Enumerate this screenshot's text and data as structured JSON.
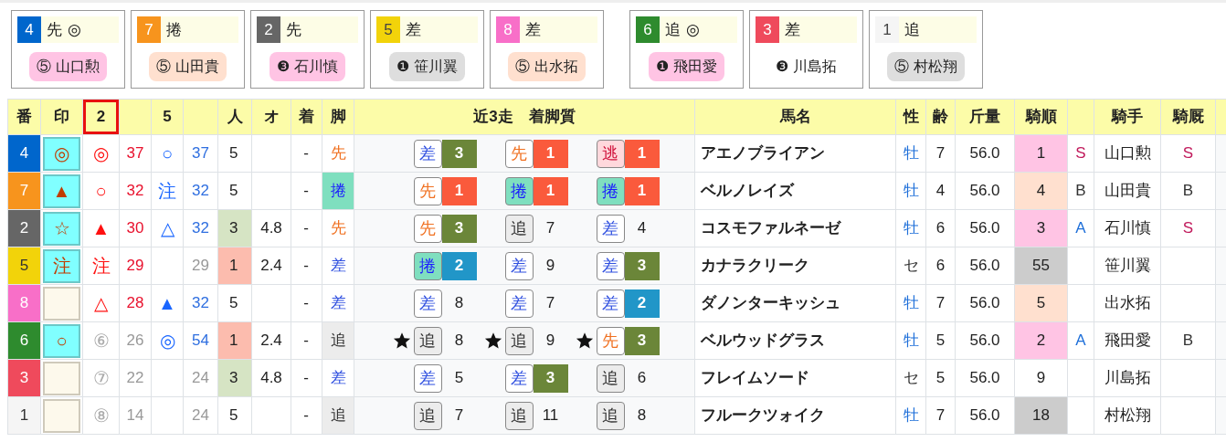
{
  "card_groups": [
    {
      "cards": [
        {
          "number": "4",
          "color": "#0066cc",
          "style": "先",
          "mark": "◎",
          "jockey": {
            "text": "⑤ 山口勲",
            "color": "#ffc4e4"
          }
        },
        {
          "number": "7",
          "color": "#f7941d",
          "style": "捲",
          "jockey": {
            "text": "⑤ 山田貴",
            "color": "#ffe0cf"
          }
        },
        {
          "number": "2",
          "color": "#666666",
          "style": "先",
          "jockey": {
            "text": "❸ 石川慎",
            "color": "#ffc4e4"
          }
        },
        {
          "number": "5",
          "color": "#f2d30a",
          "style": "差",
          "jockey": {
            "text": "❶ 笹川翼",
            "color": "#dedede"
          }
        },
        {
          "number": "8",
          "color": "#f86fc8",
          "style": "差",
          "jockey": {
            "text": "⑤ 出水拓",
            "color": "#ffe0cf"
          }
        }
      ]
    },
    {
      "cards": [
        {
          "number": "6",
          "color": "#2e8b2e",
          "style": "追",
          "mark": "◎",
          "jockey": {
            "text": "❶ 飛田愛",
            "color": "#ffc4e4"
          }
        },
        {
          "number": "3",
          "color": "#ef4a5c",
          "style": "差",
          "jockey": {
            "text": "❸ 川島拓"
          }
        },
        {
          "number": "1",
          "color": "#f5f5f5",
          "style": "追",
          "jockey": {
            "text": "⑤ 村松翔",
            "color": "#dedede"
          }
        }
      ]
    }
  ],
  "table": {
    "columns": [
      {
        "kind": "label",
        "label": "番",
        "selected": false
      },
      {
        "kind": "label",
        "label": "印",
        "selected": false
      },
      {
        "kind": "label",
        "label": "2",
        "selected": true
      },
      {
        "kind": "blank",
        "selected": false
      },
      {
        "kind": "label",
        "label": "5",
        "selected": false
      },
      {
        "kind": "blank",
        "selected": false
      },
      {
        "kind": "label",
        "label": "人",
        "selected": false
      },
      {
        "kind": "label",
        "label": "オ",
        "selected": false
      },
      {
        "kind": "label",
        "label": "着",
        "selected": false
      },
      {
        "kind": "label",
        "label": "脚",
        "selected": false
      },
      {
        "kind": "label",
        "label": "近3走　着脚質",
        "selected": false
      },
      {
        "kind": "label",
        "label": "馬名",
        "selected": false
      },
      {
        "kind": "label",
        "label": "性",
        "selected": false
      },
      {
        "kind": "label",
        "label": "齢",
        "selected": false
      },
      {
        "kind": "label",
        "label": "斤量",
        "selected": false
      },
      {
        "kind": "label",
        "label": "騎順",
        "selected": false
      },
      {
        "kind": "blank",
        "selected": false
      },
      {
        "kind": "label",
        "label": "騎手",
        "selected": false
      },
      {
        "kind": "label",
        "label": "騎厩",
        "selected": false
      },
      {
        "kind": "blank",
        "selected": false
      }
    ],
    "rows": [
      {
        "number": "4",
        "color": "#0066cc",
        "mark": "◎",
        "index_2": {
          "mark": "◎",
          "value": "37",
          "emphasized": true
        },
        "index_5": {
          "mark": "○",
          "value": "37",
          "emphasized": true
        },
        "popularity": {
          "text": "5"
        },
        "finish": "-",
        "style": {
          "text": "先",
          "kind": "senko"
        },
        "runs": [
          {
            "starred": false,
            "style": {
              "text": "差",
              "kind": "sashi"
            },
            "finish": "3",
            "color": "#6b8639"
          },
          {
            "starred": false,
            "style": {
              "text": "先",
              "kind": "senko"
            },
            "finish": "1",
            "color": "#fa5a3c"
          },
          {
            "starred": false,
            "style": {
              "text": "逃",
              "kind": "nige"
            },
            "finish": "1",
            "color": "#fa5a3c"
          }
        ],
        "name": "アエノブライアン",
        "sex": {
          "text": "牡",
          "color": "#1e6fd9"
        },
        "age": "7",
        "weight": "56.0",
        "jockey_rank": {
          "text": "1",
          "color": "#ffc4e4"
        },
        "grade": {
          "text": "S",
          "color": "#c0185a"
        },
        "jockey": "山口勲",
        "stable_grade": {
          "text": "S",
          "color": "#c0185a"
        }
      },
      {
        "number": "7",
        "color": "#f7941d",
        "mark": "▲",
        "index_2": {
          "mark": "○",
          "value": "32",
          "emphasized": true
        },
        "index_5": {
          "mark": "注",
          "value": "32",
          "emphasized": true
        },
        "popularity": {
          "text": "5"
        },
        "finish": "-",
        "style": {
          "text": "捲",
          "kind": "makuri"
        },
        "runs": [
          {
            "starred": false,
            "style": {
              "text": "先",
              "kind": "senko"
            },
            "finish": "1",
            "color": "#fa5a3c"
          },
          {
            "starred": false,
            "style": {
              "text": "捲",
              "kind": "makuri"
            },
            "finish": "1",
            "color": "#fa5a3c"
          },
          {
            "starred": false,
            "style": {
              "text": "捲",
              "kind": "makuri"
            },
            "finish": "1",
            "color": "#fa5a3c"
          }
        ],
        "name": "ベルノレイズ",
        "sex": {
          "text": "牡",
          "color": "#1e6fd9"
        },
        "age": "4",
        "weight": "56.0",
        "jockey_rank": {
          "text": "4",
          "color": "#ffe0cf"
        },
        "grade": {
          "text": "B",
          "color": "#333333"
        },
        "jockey": "山田貴",
        "stable_grade": {
          "text": "B",
          "color": "#333333"
        }
      },
      {
        "number": "2",
        "color": "#666666",
        "mark": "☆",
        "index_2": {
          "mark": "▲",
          "value": "30",
          "emphasized": true
        },
        "index_5": {
          "mark": "△",
          "value": "32",
          "emphasized": true
        },
        "popularity": {
          "text": "3",
          "color": "#d6e4c4"
        },
        "odds": "4.8",
        "finish": "-",
        "style": {
          "text": "先",
          "kind": "senko"
        },
        "runs": [
          {
            "starred": false,
            "style": {
              "text": "先",
              "kind": "senko"
            },
            "finish": "3",
            "color": "#6b8639"
          },
          {
            "starred": false,
            "style": {
              "text": "追",
              "kind": "oikomi"
            },
            "finish": "7"
          },
          {
            "starred": false,
            "style": {
              "text": "差",
              "kind": "sashi"
            },
            "finish": "4"
          }
        ],
        "name": "コスモファルネーゼ",
        "sex": {
          "text": "牡",
          "color": "#1e6fd9"
        },
        "age": "6",
        "weight": "56.0",
        "jockey_rank": {
          "text": "3",
          "color": "#ffc4e4"
        },
        "grade": {
          "text": "A",
          "color": "#1e6fd9"
        },
        "jockey": "石川慎",
        "stable_grade": {
          "text": "S",
          "color": "#c0185a"
        }
      },
      {
        "number": "5",
        "color": "#f2d30a",
        "mark": "注",
        "index_2": {
          "mark": "注",
          "value": "29",
          "emphasized": true
        },
        "index_5": {
          "value": "29",
          "emphasized": false
        },
        "popularity": {
          "text": "1",
          "color": "#fcbcae"
        },
        "odds": "2.4",
        "finish": "-",
        "style": {
          "text": "差",
          "kind": "sashi"
        },
        "runs": [
          {
            "starred": false,
            "style": {
              "text": "捲",
              "kind": "makuri"
            },
            "finish": "2",
            "color": "#2196c8"
          },
          {
            "starred": false,
            "style": {
              "text": "差",
              "kind": "sashi"
            },
            "finish": "9"
          },
          {
            "starred": false,
            "style": {
              "text": "差",
              "kind": "sashi"
            },
            "finish": "3",
            "color": "#6b8639"
          }
        ],
        "name": "カナラクリーク",
        "sex": {
          "text": "セ",
          "color": "#333333"
        },
        "age": "6",
        "weight": "56.0",
        "jockey_rank": {
          "text": "55",
          "color": "#cccccc"
        },
        "jockey": "笹川翼"
      },
      {
        "number": "8",
        "color": "#f86fc8",
        "index_2": {
          "mark": "△",
          "value": "28",
          "emphasized": true
        },
        "index_5": {
          "mark": "▲",
          "value": "32",
          "emphasized": true
        },
        "popularity": {
          "text": "5"
        },
        "finish": "-",
        "style": {
          "text": "差",
          "kind": "sashi"
        },
        "runs": [
          {
            "starred": false,
            "style": {
              "text": "差",
              "kind": "sashi"
            },
            "finish": "8"
          },
          {
            "starred": false,
            "style": {
              "text": "差",
              "kind": "sashi"
            },
            "finish": "7"
          },
          {
            "starred": false,
            "style": {
              "text": "差",
              "kind": "sashi"
            },
            "finish": "2",
            "color": "#2196c8"
          }
        ],
        "name": "ダノンターキッシュ",
        "sex": {
          "text": "牡",
          "color": "#1e6fd9"
        },
        "age": "7",
        "weight": "56.0",
        "jockey_rank": {
          "text": "5",
          "color": "#ffe0cf"
        },
        "jockey": "出水拓"
      },
      {
        "number": "6",
        "color": "#2e8b2e",
        "mark": "○",
        "index_2": {
          "mark": "⑥",
          "value": "26",
          "emphasized": false
        },
        "index_5": {
          "mark": "◎",
          "value": "54",
          "emphasized": true
        },
        "popularity": {
          "text": "1",
          "color": "#fcbcae"
        },
        "odds": "2.4",
        "finish": "-",
        "style": {
          "text": "追",
          "kind": "oikomi"
        },
        "runs": [
          {
            "starred": true,
            "style": {
              "text": "追",
              "kind": "oikomi"
            },
            "finish": "8"
          },
          {
            "starred": true,
            "style": {
              "text": "追",
              "kind": "oikomi"
            },
            "finish": "9"
          },
          {
            "starred": true,
            "style": {
              "text": "先",
              "kind": "senko"
            },
            "finish": "3",
            "color": "#6b8639"
          }
        ],
        "name": "ベルウッドグラス",
        "sex": {
          "text": "牡",
          "color": "#1e6fd9"
        },
        "age": "5",
        "weight": "56.0",
        "jockey_rank": {
          "text": "2",
          "color": "#ffc4e4"
        },
        "grade": {
          "text": "A",
          "color": "#1e6fd9"
        },
        "jockey": "飛田愛",
        "stable_grade": {
          "text": "B",
          "color": "#333333"
        }
      },
      {
        "number": "3",
        "color": "#ef4a5c",
        "index_2": {
          "mark": "⑦",
          "value": "22",
          "emphasized": false
        },
        "index_5": {
          "value": "24",
          "emphasized": false
        },
        "popularity": {
          "text": "3",
          "color": "#d6e4c4"
        },
        "odds": "4.8",
        "finish": "-",
        "style": {
          "text": "差",
          "kind": "sashi"
        },
        "runs": [
          {
            "starred": false,
            "style": {
              "text": "差",
              "kind": "sashi"
            },
            "finish": "5"
          },
          {
            "starred": false,
            "style": {
              "text": "差",
              "kind": "sashi"
            },
            "finish": "3",
            "color": "#6b8639"
          },
          {
            "starred": false,
            "style": {
              "text": "追",
              "kind": "oikomi"
            },
            "finish": "6"
          }
        ],
        "name": "フレイムソード",
        "sex": {
          "text": "セ",
          "color": "#333333"
        },
        "age": "5",
        "weight": "56.0",
        "jockey_rank": {
          "text": "9"
        },
        "jockey": "川島拓"
      },
      {
        "number": "1",
        "color": "#f5f5f5",
        "index_2": {
          "mark": "⑧",
          "value": "14",
          "emphasized": false
        },
        "index_5": {
          "value": "24",
          "emphasized": false
        },
        "popularity": {
          "text": "5"
        },
        "finish": "-",
        "style": {
          "text": "追",
          "kind": "oikomi"
        },
        "runs": [
          {
            "starred": false,
            "style": {
              "text": "追",
              "kind": "oikomi"
            },
            "finish": "7"
          },
          {
            "starred": false,
            "style": {
              "text": "追",
              "kind": "oikomi"
            },
            "finish": "11"
          },
          {
            "starred": false,
            "style": {
              "text": "追",
              "kind": "oikomi"
            },
            "finish": "8"
          }
        ],
        "name": "フルークツォイク",
        "sex": {
          "text": "牡",
          "color": "#1e6fd9"
        },
        "age": "7",
        "weight": "56.0",
        "jockey_rank": {
          "text": "18",
          "color": "#cccccc"
        },
        "jockey": "村松翔"
      }
    ]
  }
}
